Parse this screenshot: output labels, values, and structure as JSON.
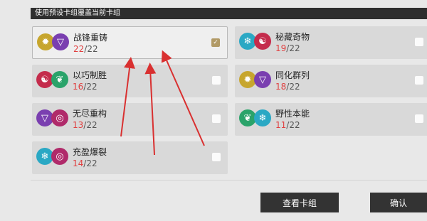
{
  "header": {
    "title": "使用预设卡组覆盖当前卡组"
  },
  "decks": [
    {
      "name": "战锋重铸",
      "current": "22",
      "total": "/22",
      "selected": true,
      "icons": [
        {
          "name": "sun-icon",
          "color": "#c7a62e",
          "glyph": "✹"
        },
        {
          "name": "triangle-mask-icon",
          "color": "#7a3fb0",
          "glyph": "▽"
        }
      ]
    },
    {
      "name": "秘藏奇物",
      "current": "19",
      "total": "/22",
      "selected": false,
      "icons": [
        {
          "name": "snowflake-icon",
          "color": "#2aa8c4",
          "glyph": "❄"
        },
        {
          "name": "yin-yang-icon",
          "color": "#c42c4c",
          "glyph": "☯"
        }
      ]
    },
    {
      "name": "以巧制胜",
      "current": "16",
      "total": "/22",
      "selected": false,
      "icons": [
        {
          "name": "yin-yang-icon",
          "color": "#c42c4c",
          "glyph": "☯"
        },
        {
          "name": "leaf-icon",
          "color": "#2aa36a",
          "glyph": "❦"
        }
      ]
    },
    {
      "name": "同化群列",
      "current": "18",
      "total": "/22",
      "selected": false,
      "icons": [
        {
          "name": "sun-icon",
          "color": "#c7a62e",
          "glyph": "✹"
        },
        {
          "name": "triangle-mask-icon",
          "color": "#7a3fb0",
          "glyph": "▽"
        }
      ]
    },
    {
      "name": "无尽重构",
      "current": "13",
      "total": "/22",
      "selected": false,
      "icons": [
        {
          "name": "triangle-mask-icon",
          "color": "#7a3fb0",
          "glyph": "▽"
        },
        {
          "name": "spiral-icon",
          "color": "#b02a6a",
          "glyph": "◎"
        }
      ]
    },
    {
      "name": "野性本能",
      "current": "11",
      "total": "/22",
      "selected": false,
      "icons": [
        {
          "name": "leaf-icon",
          "color": "#2aa36a",
          "glyph": "❦"
        },
        {
          "name": "snowflake-icon",
          "color": "#2aa8c4",
          "glyph": "❄"
        }
      ]
    },
    {
      "name": "充盈爆裂",
      "current": "14",
      "total": "/22",
      "selected": false,
      "icons": [
        {
          "name": "snowflake-icon",
          "color": "#2aa8c4",
          "glyph": "❄"
        },
        {
          "name": "spiral-icon",
          "color": "#b02a6a",
          "glyph": "◎"
        }
      ]
    }
  ],
  "checkmark": "✓",
  "buttons": {
    "view": "查看卡组",
    "confirm": "确认"
  },
  "colors": {
    "count_current": "#e04040",
    "annotation_arrow": "#d93030",
    "checkbox_selected": "#b19a66"
  }
}
